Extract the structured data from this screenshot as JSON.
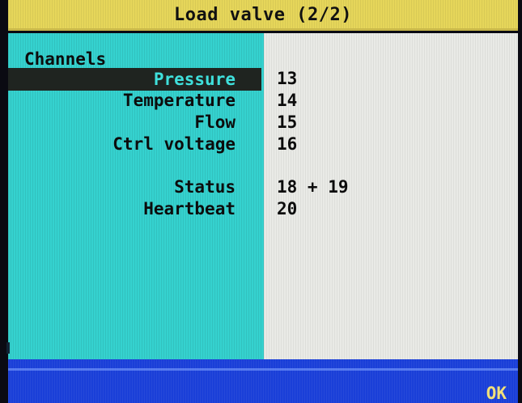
{
  "window": {
    "title": "Load valve (2/2)"
  },
  "section": {
    "heading": "Channels"
  },
  "rows": [
    {
      "label": "Pressure",
      "value": "13"
    },
    {
      "label": "Temperature",
      "value": "14"
    },
    {
      "label": "Flow",
      "value": "15"
    },
    {
      "label": "Ctrl voltage",
      "value": "16"
    },
    {
      "label": "Status",
      "value": "18 + 19"
    },
    {
      "label": "Heartbeat",
      "value": "20"
    }
  ],
  "footer": {
    "ok_label": "OK"
  },
  "colors": {
    "title_bar": "#e6d65a",
    "left_panel": "#35d2cf",
    "right_panel": "#e9eae6",
    "selection": "#1f2420",
    "bottom_bar": "#1a3fd8",
    "ok_text": "#f2e07a"
  }
}
